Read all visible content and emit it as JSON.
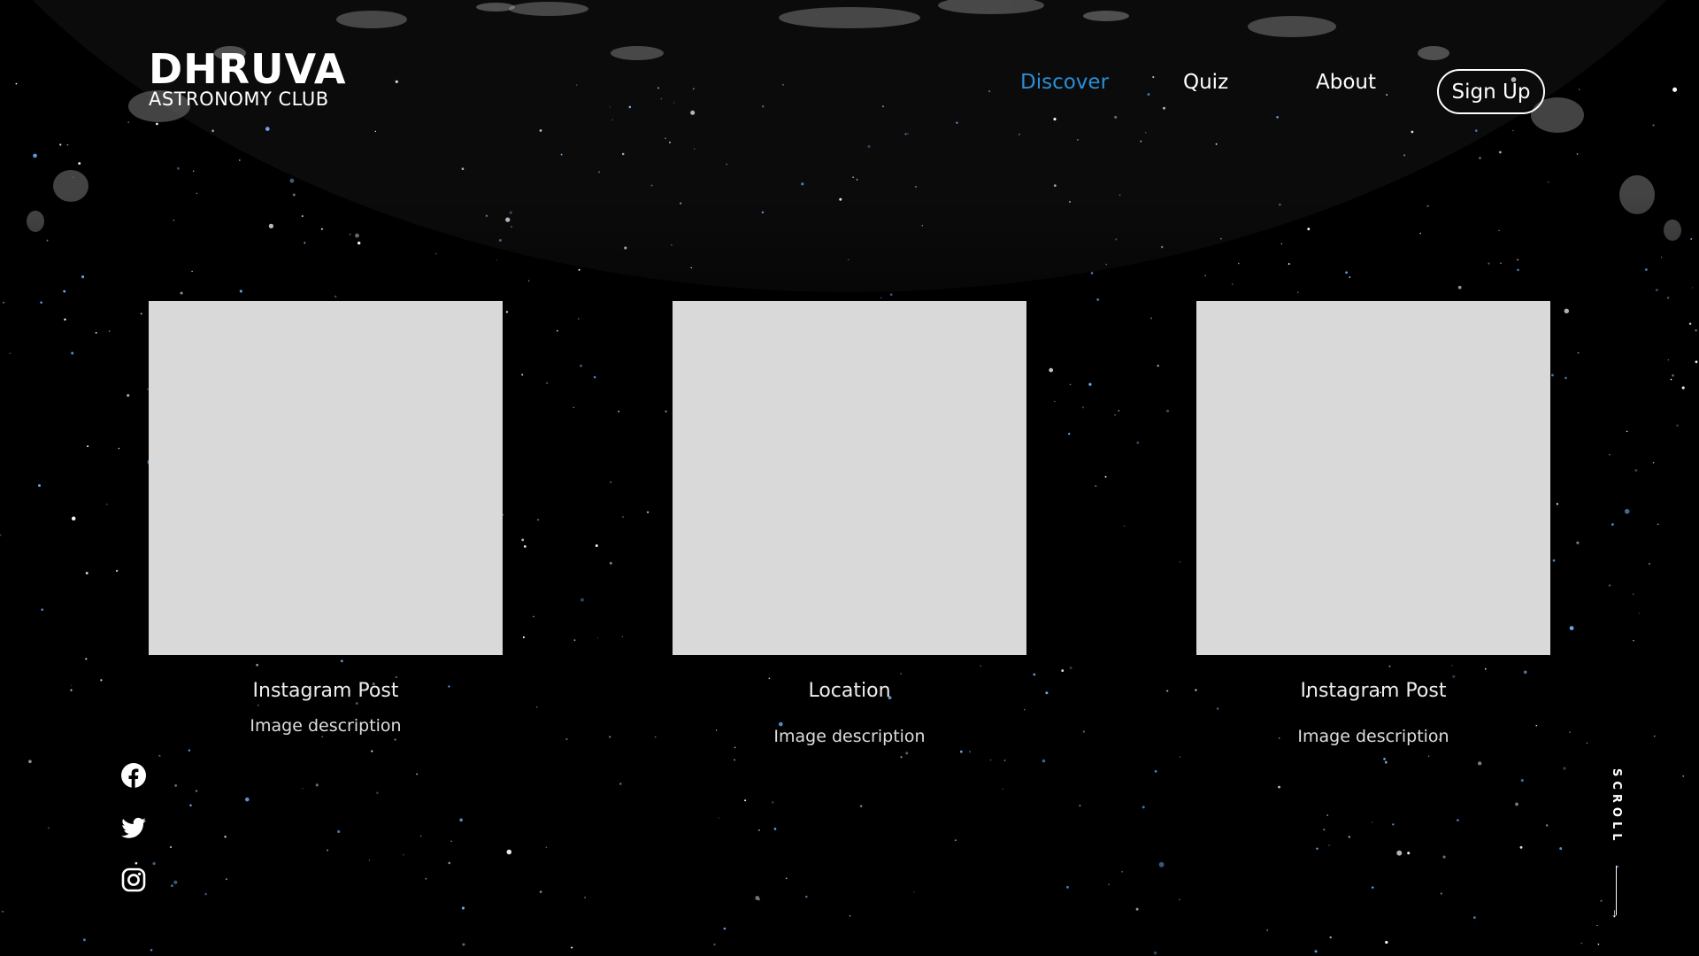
{
  "brand": {
    "name": "DHRUVA",
    "subtitle": "ASTRONOMY CLUB"
  },
  "nav": {
    "items": [
      {
        "label": "Discover",
        "active": true
      },
      {
        "label": "Quiz",
        "active": false
      },
      {
        "label": "About",
        "active": false
      }
    ],
    "signup_label": "Sign Up"
  },
  "cards": [
    {
      "title": "Instagram Post",
      "description": "Image description"
    },
    {
      "title": "Location",
      "description": "Image description"
    },
    {
      "title": "Instagram Post",
      "description": "Image description"
    }
  ],
  "social": [
    "facebook-icon",
    "twitter-icon",
    "instagram-icon"
  ],
  "scroll": {
    "label": "SCROLL"
  },
  "colors": {
    "accent": "#2a8fd6",
    "background": "#000000",
    "card": "#d9d9d9",
    "text": "#ffffff"
  }
}
